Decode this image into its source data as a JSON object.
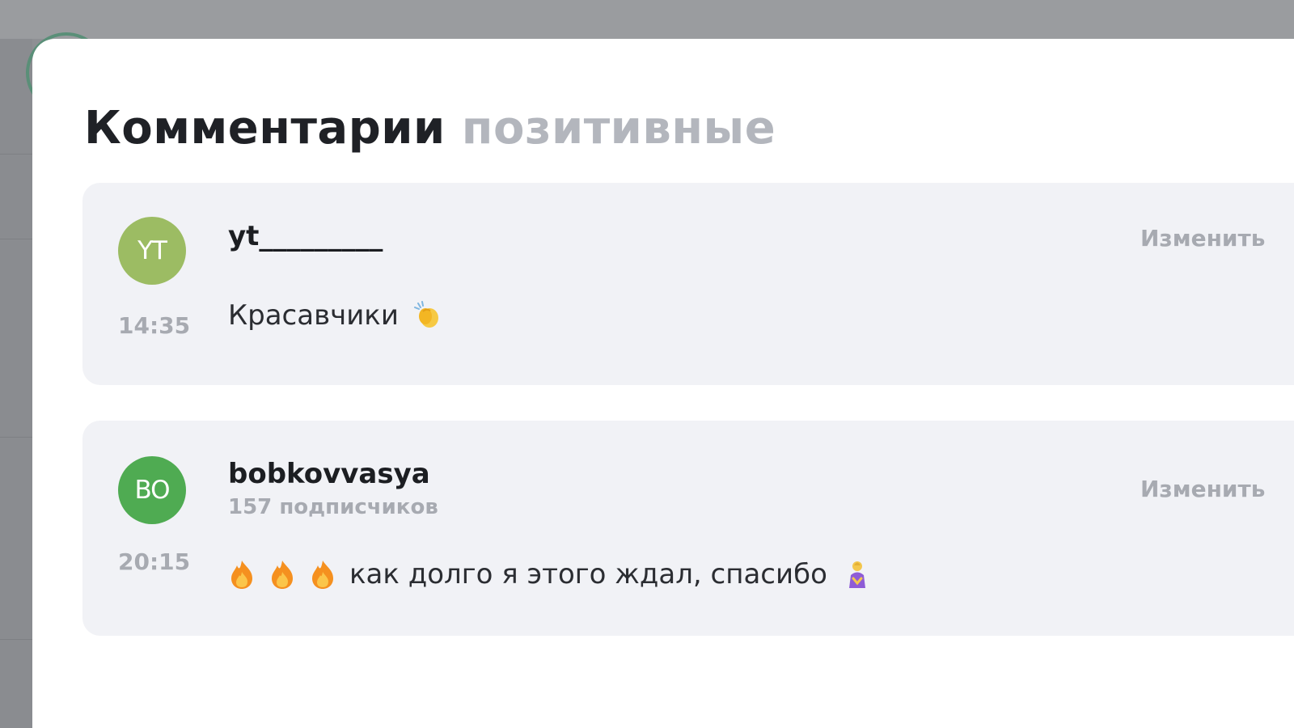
{
  "modal": {
    "title_main": "Комментарии",
    "title_sub": "позитивные"
  },
  "comments": [
    {
      "avatar_initials": "YT",
      "avatar_color": "#9cbc63",
      "username": "yt_________",
      "time": "14:35",
      "edit_label": "Изменить",
      "text": "Красавчики",
      "emoji_after": "clapping-hands-icon"
    },
    {
      "avatar_initials": "BO",
      "avatar_color": "#4fab52",
      "username": "bobkovvasya",
      "subscribers": "157 подписчиков",
      "time": "20:15",
      "edit_label": "Изменить",
      "emoji_before": [
        "fire-icon",
        "fire-icon",
        "fire-icon"
      ],
      "text": "как долго я этого ждал, спасибо",
      "emoji_after": "person-bowing-icon"
    }
  ],
  "colors": {
    "title": "#1f2126",
    "title_muted": "#b3b6bd",
    "card_background": "#f1f2f6",
    "muted_text": "#a7aab1",
    "overlay": "#8e9094"
  }
}
